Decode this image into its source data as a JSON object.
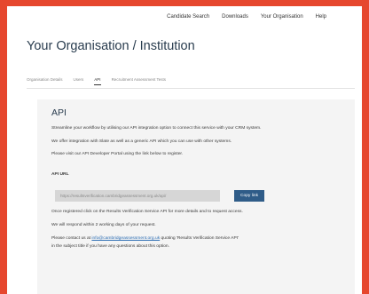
{
  "topnav": {
    "items": [
      "Candidate Search",
      "Downloads",
      "Your Organisation",
      "Help"
    ]
  },
  "page": {
    "title": "Your Organisation / Institution"
  },
  "tabs": [
    {
      "label": "Organisation Details",
      "active": false
    },
    {
      "label": "Users",
      "active": false
    },
    {
      "label": "API",
      "active": true
    },
    {
      "label": "Recruitment Assessment Tests",
      "active": false
    }
  ],
  "api": {
    "title": "API",
    "intro": "Streamline your workflow by utilising our API integration option to connect this service with your CRM system.",
    "offer": "We offer integration with Slate as well as a generic API which you can use with other systems.",
    "visit": "Please visit our API Developer Portal using the link below to register.",
    "url_label": "API URL",
    "url_value": "https://resultsverification.cambridgeassessment.org.uk/api/",
    "copy_label": "Copy link",
    "registered": "Once registered click on the Results Verification Service API for more details and to request access.",
    "respond": "We will respond within 2 working days of your request.",
    "contact_prefix": "Please contact us at ",
    "contact_email": "info@cambridgeassessment.org.uk",
    "contact_suffix": " quoting 'Results Verification Service API'",
    "contact_line2": "in the subject title if you have any questions about this option."
  },
  "colors": {
    "outer_border": "#e6472e",
    "title": "#2a3d4f",
    "button": "#2f5c88",
    "link": "#2f6fb4",
    "panel": "#f4f4f4"
  }
}
